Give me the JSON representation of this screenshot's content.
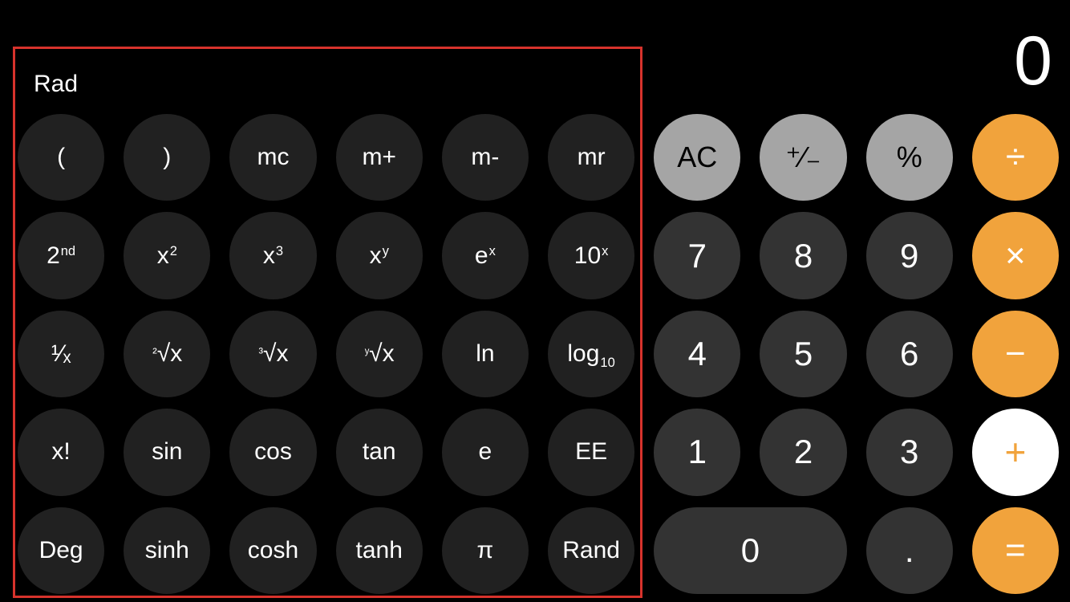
{
  "display": {
    "value": "0"
  },
  "mode": {
    "label": "Rad"
  },
  "colors": {
    "orange": "#f1a33c",
    "lightGray": "#a5a5a5",
    "darkKey": "#212121",
    "numKey": "#333333",
    "highlight": "#d7332c"
  },
  "keys": {
    "r1": {
      "lparen": "(",
      "rparen": ")",
      "mc": "mc",
      "mplus": "m+",
      "mminus": "m-",
      "mr": "mr",
      "ac": "AC",
      "sign": "⁺⁄₋",
      "percent": "%",
      "divide": "÷"
    },
    "r2": {
      "second_base": "2",
      "second_sup": "nd",
      "x2_base": "x",
      "x2_sup": "2",
      "x3_base": "x",
      "x3_sup": "3",
      "xy_base": "x",
      "xy_sup": "y",
      "ex_base": "e",
      "ex_sup": "x",
      "tenx_base": "10",
      "tenx_sup": "x",
      "d7": "7",
      "d8": "8",
      "d9": "9",
      "times": "×"
    },
    "r3": {
      "inv": "¹⁄ₓ",
      "sqrt_pre": "²",
      "sqrt_rad": "√x",
      "cbrt_pre": "³",
      "cbrt_rad": "√x",
      "yroot_pre": "ʸ",
      "yroot_rad": "√x",
      "ln": "ln",
      "log_base": "log",
      "log_sub": "10",
      "d4": "4",
      "d5": "5",
      "d6": "6",
      "minus": "−"
    },
    "r4": {
      "fact": "x!",
      "sin": "sin",
      "cos": "cos",
      "tan": "tan",
      "e": "e",
      "ee": "EE",
      "d1": "1",
      "d2": "2",
      "d3": "3",
      "plus": "+"
    },
    "r5": {
      "deg": "Deg",
      "sinh": "sinh",
      "cosh": "cosh",
      "tanh": "tanh",
      "pi": "π",
      "rand": "Rand",
      "d0": "0",
      "dot": ".",
      "equals": "="
    }
  }
}
